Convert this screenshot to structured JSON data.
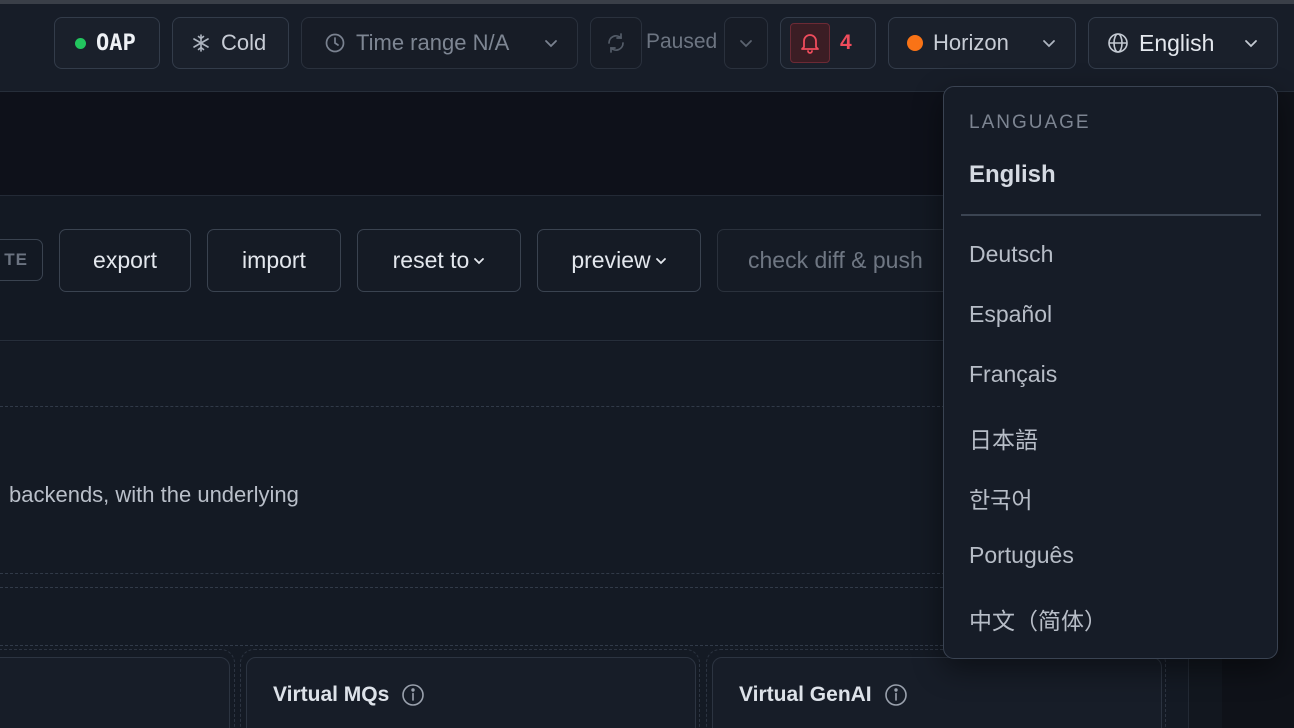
{
  "topbar": {
    "oap_label": "OAP",
    "oap_status_color": "#22c55e",
    "cold_label": "Cold",
    "time_range_label": "Time range N/A",
    "paused_label": "Paused",
    "alert_count": "4",
    "alert_color": "#ef4c5c",
    "theme_label": "Horizon",
    "theme_color": "#f97316",
    "language_label": "English"
  },
  "toolbar": {
    "badge_text": "TE",
    "export_label": "export",
    "import_label": "import",
    "reset_label": "reset to",
    "preview_label": "preview",
    "check_diff_label": "check diff & push"
  },
  "content": {
    "description": "backends, with the underlying",
    "cards": [
      {
        "title": "Virtual MQs"
      },
      {
        "title": "Virtual GenAI"
      }
    ]
  },
  "language_menu": {
    "header": "LANGUAGE",
    "current": "English",
    "options": [
      "Deutsch",
      "Español",
      "Français",
      "日本語",
      "한국어",
      "Português",
      "中文（简体）"
    ]
  }
}
